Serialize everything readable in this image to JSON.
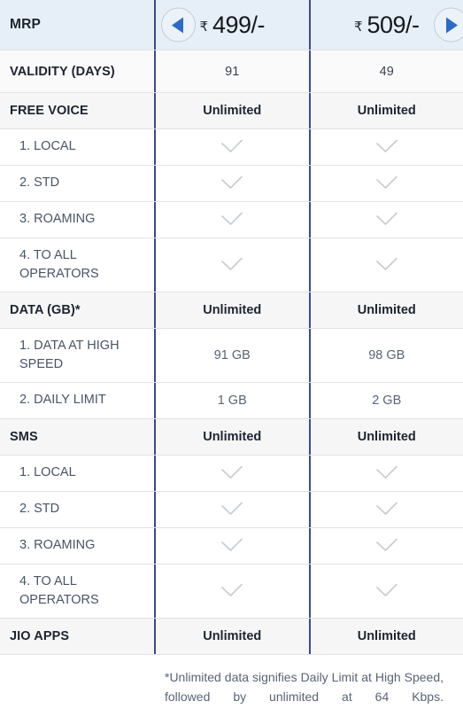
{
  "table": {
    "columns": [
      {
        "currency": "₹",
        "price": "499/-"
      },
      {
        "currency": "₹",
        "price": "509/-"
      }
    ],
    "nav": {
      "prev_label": "◀",
      "next_label": "▶"
    },
    "rows": [
      {
        "type": "mrp",
        "label": "MRP"
      },
      {
        "type": "validity",
        "label": "VALIDITY (DAYS)",
        "values": [
          "91",
          "49"
        ]
      },
      {
        "type": "section",
        "label": "FREE VOICE",
        "values": [
          "Unlimited",
          "Unlimited"
        ]
      },
      {
        "type": "sub",
        "label": "1. LOCAL",
        "values": [
          "check",
          "check"
        ]
      },
      {
        "type": "sub",
        "label": "2. STD",
        "values": [
          "check",
          "check"
        ]
      },
      {
        "type": "sub",
        "label": "3. ROAMING",
        "values": [
          "check",
          "check"
        ]
      },
      {
        "type": "sub",
        "label": "4. TO ALL",
        "label2": "OPERATORS",
        "tall": true,
        "values": [
          "check",
          "check"
        ]
      },
      {
        "type": "section",
        "label": "DATA (GB)*",
        "values": [
          "Unlimited",
          "Unlimited"
        ]
      },
      {
        "type": "sub",
        "label": "1. DATA AT HIGH",
        "label2": "SPEED",
        "tall": true,
        "values": [
          "91 GB",
          "98 GB"
        ]
      },
      {
        "type": "sub",
        "label": "2. DAILY LIMIT",
        "values": [
          "1 GB",
          "2 GB"
        ]
      },
      {
        "type": "section",
        "label": "SMS",
        "values": [
          "Unlimited",
          "Unlimited"
        ]
      },
      {
        "type": "sub",
        "label": "1. LOCAL",
        "values": [
          "check",
          "check"
        ]
      },
      {
        "type": "sub",
        "label": "2. STD",
        "values": [
          "check",
          "check"
        ]
      },
      {
        "type": "sub",
        "label": "3. ROAMING",
        "values": [
          "check",
          "check"
        ]
      },
      {
        "type": "sub",
        "label": "4. TO ALL",
        "label2": "OPERATORS",
        "tall": true,
        "values": [
          "check",
          "check"
        ]
      },
      {
        "type": "section",
        "label": "JIO APPS",
        "values": [
          "Unlimited",
          "Unlimited"
        ]
      }
    ],
    "footnote": "*Unlimited data signifies Daily Limit at High Speed, followed by unlimited at 64 Kbps."
  },
  "colors": {
    "header_bg": "#e6eef7",
    "section_bg": "#f6f6f6",
    "divider": "#3c4a8e",
    "arrow": "#2b6cc4",
    "check": "#c9cdd3"
  }
}
